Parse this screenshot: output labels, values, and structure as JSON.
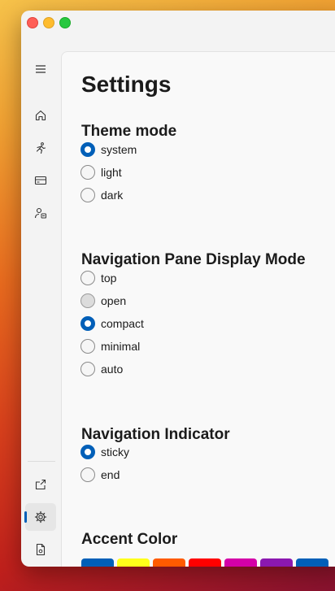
{
  "window": {
    "controls": [
      "close",
      "minimize",
      "zoom"
    ]
  },
  "nav": {
    "menu_icon": "hamburger-icon",
    "items": [
      {
        "id": "home",
        "icon": "home-icon"
      },
      {
        "id": "activity",
        "icon": "running-figure-icon"
      },
      {
        "id": "cards",
        "icon": "card-icon"
      },
      {
        "id": "account",
        "icon": "person-badge-icon"
      }
    ],
    "footer_items": [
      {
        "id": "external",
        "icon": "open-external-icon"
      },
      {
        "id": "settings",
        "icon": "gear-icon",
        "selected": true
      },
      {
        "id": "document",
        "icon": "document-settings-icon"
      }
    ]
  },
  "page": {
    "title": "Settings"
  },
  "theme_mode": {
    "title": "Theme mode",
    "options": [
      {
        "label": "system",
        "checked": true
      },
      {
        "label": "light",
        "checked": false
      },
      {
        "label": "dark",
        "checked": false
      }
    ]
  },
  "nav_display_mode": {
    "title": "Navigation Pane Display Mode",
    "options": [
      {
        "label": "top",
        "checked": false
      },
      {
        "label": "open",
        "checked": false,
        "hover": true
      },
      {
        "label": "compact",
        "checked": true
      },
      {
        "label": "minimal",
        "checked": false
      },
      {
        "label": "auto",
        "checked": false
      }
    ]
  },
  "nav_indicator": {
    "title": "Navigation Indicator",
    "options": [
      {
        "label": "sticky",
        "checked": true
      },
      {
        "label": "end",
        "checked": false
      }
    ]
  },
  "accent_color": {
    "title": "Accent Color",
    "swatches": [
      {
        "color": "#005fb8",
        "selected": true
      },
      {
        "color": "#ffff1a",
        "selected": false
      },
      {
        "color": "#ff5a00",
        "selected": false
      },
      {
        "color": "#ff0000",
        "selected": false
      },
      {
        "color": "#d400a8",
        "selected": false
      },
      {
        "color": "#8b18b0",
        "selected": false
      },
      {
        "color": "#005fb8",
        "selected": true
      }
    ]
  }
}
